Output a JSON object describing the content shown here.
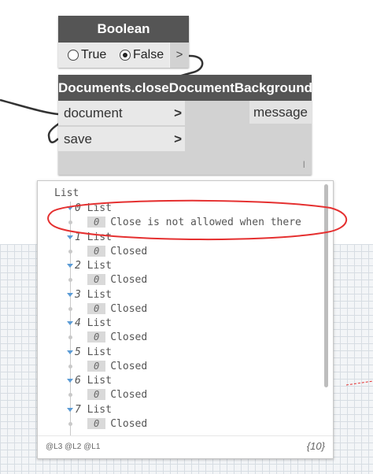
{
  "boolean_node": {
    "title": "Boolean",
    "option_true": "True",
    "option_false": "False",
    "selected": "False",
    "output_port": ">"
  },
  "documents_node": {
    "title": "Documents.closeDocumentBackground",
    "input_document": "document",
    "input_save": "save",
    "output_message": "message",
    "port_chevron": ">",
    "grip": "I"
  },
  "preview": {
    "root_label": "List",
    "items": [
      {
        "index": "0",
        "list_label": "List",
        "value_index": "0",
        "value": "Close is not allowed when there"
      },
      {
        "index": "1",
        "list_label": "List",
        "value_index": "0",
        "value": "Closed"
      },
      {
        "index": "2",
        "list_label": "List",
        "value_index": "0",
        "value": "Closed"
      },
      {
        "index": "3",
        "list_label": "List",
        "value_index": "0",
        "value": "Closed"
      },
      {
        "index": "4",
        "list_label": "List",
        "value_index": "0",
        "value": "Closed"
      },
      {
        "index": "5",
        "list_label": "List",
        "value_index": "0",
        "value": "Closed"
      },
      {
        "index": "6",
        "list_label": "List",
        "value_index": "0",
        "value": "Closed"
      },
      {
        "index": "7",
        "list_label": "List",
        "value_index": "0",
        "value": "Closed"
      }
    ],
    "levels": "@L3 @L2 @L1",
    "count": "{10}"
  },
  "colors": {
    "node_header": "#555555",
    "annotation_ellipse": "#e53030",
    "tree_triangle": "#5b9bd5"
  }
}
